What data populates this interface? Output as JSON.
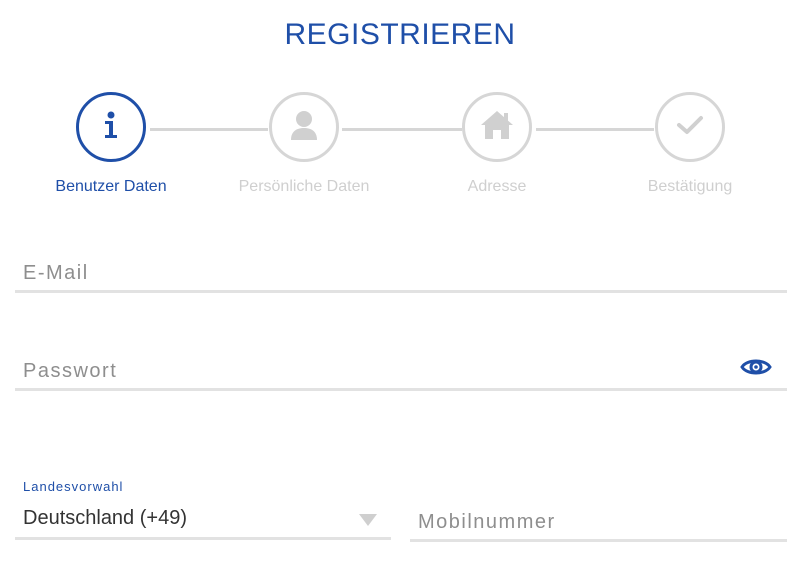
{
  "header": {
    "title": "REGISTRIEREN"
  },
  "stepper": {
    "active_color": "#1f4fa8",
    "inactive_color": "#d6d6d6",
    "steps": [
      {
        "label": "Benutzer Daten",
        "icon": "info-icon",
        "active": true
      },
      {
        "label": "Persönliche Daten",
        "icon": "person-icon",
        "active": false
      },
      {
        "label": "Adresse",
        "icon": "home-icon",
        "active": false
      },
      {
        "label": "Bestätigung",
        "icon": "check-icon",
        "active": false
      }
    ]
  },
  "form": {
    "email": {
      "placeholder": "E-Mail",
      "value": ""
    },
    "password": {
      "placeholder": "Passwort",
      "value": "",
      "toggle_icon": "eye-icon"
    },
    "country_code": {
      "label": "Landesvorwahl",
      "value": "Deutschland (+49)"
    },
    "mobile": {
      "placeholder": "Mobilnummer",
      "value": ""
    }
  }
}
